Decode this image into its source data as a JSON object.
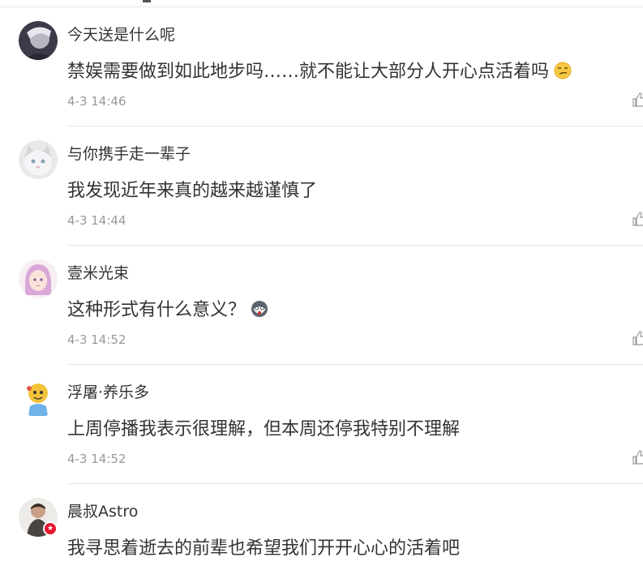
{
  "comments": [
    {
      "username": "今天送是什么呢",
      "text": "禁娱需要做到如此地步吗……就不能让大部分人开心点活着吗",
      "emoji": "smirk-emoji",
      "time": "4-3 14:46"
    },
    {
      "username": "与你携手走一辈子",
      "text": "我发现近年来真的越来越谨慎了",
      "time": "4-3 14:44"
    },
    {
      "username": "壹米光束",
      "text": "这种形式有什么意义？",
      "emoji": "shocked-husky-emoji",
      "time": "4-3 14:52"
    },
    {
      "username": "浮屠·养乐多",
      "text": "上周停播我表示很理解，但本周还停我特别不理解",
      "time": "4-3 14:52"
    },
    {
      "username": "晨叔Astro",
      "text": "我寻思着逝去的前辈也希望我们开开心心的活着吧",
      "verified_badge": "verified-badge-icon",
      "time": ""
    }
  ],
  "colors": {
    "username": "#333333",
    "time": "#999999",
    "divider": "#e8e8e8",
    "verified_badge": "#e6162d"
  }
}
